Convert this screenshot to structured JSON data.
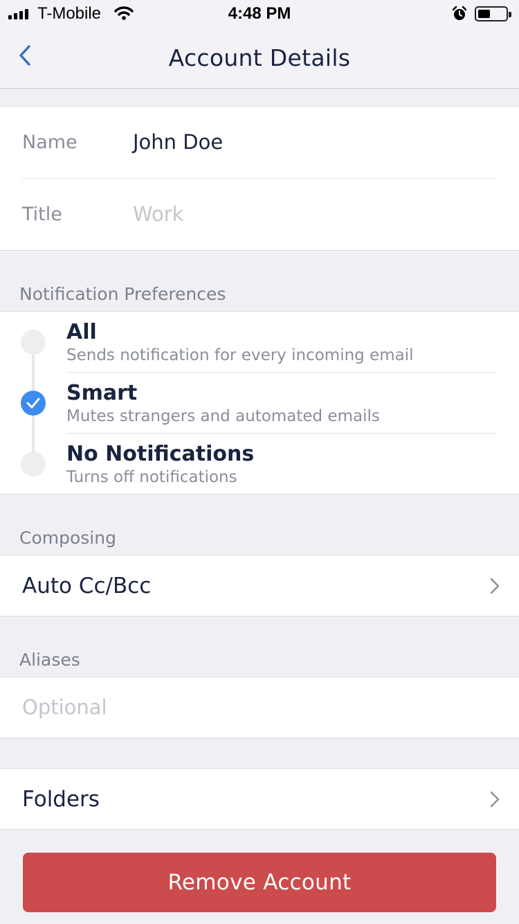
{
  "status_bar": {
    "carrier": "T-Mobile",
    "time": "4:48 PM",
    "battery_level": 0.45
  },
  "nav": {
    "title": "Account Details"
  },
  "account": {
    "name_label": "Name",
    "name_value": "John Doe",
    "title_label": "Title",
    "title_placeholder": "Work"
  },
  "notifications": {
    "header": "Notification Preferences",
    "selected": "Smart",
    "options": [
      {
        "title": "All",
        "subtitle": "Sends notification for every incoming email",
        "selected": false
      },
      {
        "title": "Smart",
        "subtitle": "Mutes strangers and automated emails",
        "selected": true
      },
      {
        "title": "No Notifications",
        "subtitle": "Turns off notifications",
        "selected": false
      }
    ]
  },
  "composing": {
    "header": "Composing",
    "auto_cc_label": "Auto Cc/Bcc"
  },
  "aliases": {
    "header": "Aliases",
    "placeholder": "Optional"
  },
  "folders": {
    "label": "Folders"
  },
  "remove_account": {
    "label": "Remove Account",
    "color": "#cc4b4c"
  },
  "colors": {
    "accent": "#3d8bf0",
    "text": "#1a2440"
  }
}
